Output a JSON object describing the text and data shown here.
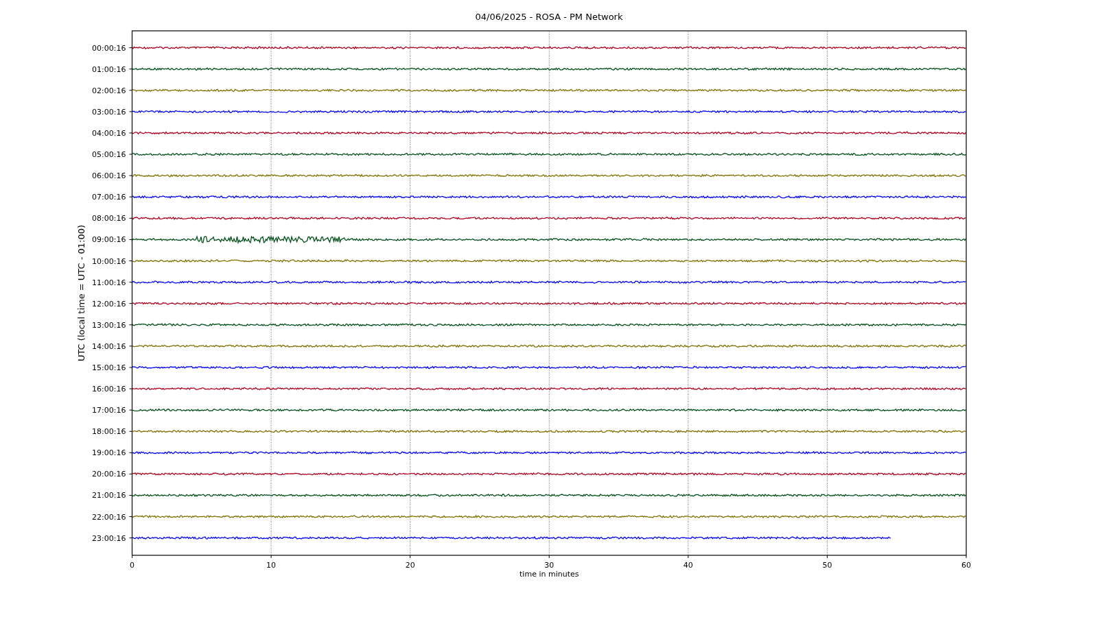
{
  "title": "04/06/2025 - ROSA - PM Network",
  "ylabel": "UTC (local time = UTC - 01:00)",
  "xlabel": "time in minutes",
  "xticks": [
    "0",
    "10",
    "20",
    "30",
    "40",
    "50",
    "60"
  ],
  "rows": [
    {
      "label": "00:00:16",
      "color": "#b00020",
      "level": 1
    },
    {
      "label": "01:00:16",
      "color": "#00501a",
      "level": 1
    },
    {
      "label": "02:00:16",
      "color": "#7f7000",
      "level": 1
    },
    {
      "label": "03:00:16",
      "color": "#0000ff",
      "level": 1
    },
    {
      "label": "04:00:16",
      "color": "#b00020",
      "level": 1
    },
    {
      "label": "05:00:16",
      "color": "#00501a",
      "level": 1
    },
    {
      "label": "06:00:16",
      "color": "#7f7000",
      "level": 1
    },
    {
      "label": "07:00:16",
      "color": "#0000ff",
      "level": 1
    },
    {
      "label": "08:00:16",
      "color": "#b00020",
      "level": 1
    },
    {
      "label": "09:00:16",
      "color": "#00501a",
      "level": 1
    },
    {
      "label": "10:00:16",
      "color": "#7f7000",
      "level": 1
    },
    {
      "label": "11:00:16",
      "color": "#0000ff",
      "level": 1
    },
    {
      "label": "12:00:16",
      "color": "#b00020",
      "level": 1
    },
    {
      "label": "13:00:16",
      "color": "#00501a",
      "level": 1
    },
    {
      "label": "14:00:16",
      "color": "#7f7000",
      "level": 1
    },
    {
      "label": "15:00:16",
      "color": "#0000ff",
      "level": 1
    },
    {
      "label": "16:00:16",
      "color": "#b00020",
      "level": 1
    },
    {
      "label": "17:00:16",
      "color": "#00501a",
      "level": 1
    },
    {
      "label": "18:00:16",
      "color": "#7f7000",
      "level": 1
    },
    {
      "label": "19:00:16",
      "color": "#0000ff",
      "level": 1
    },
    {
      "label": "20:00:16",
      "color": "#b00020",
      "level": 1
    },
    {
      "label": "21:00:16",
      "color": "#00501a",
      "level": 1
    },
    {
      "label": "22:00:16",
      "color": "#7f7000",
      "level": 1
    },
    {
      "label": "23:00:16",
      "color": "#0000ff",
      "level": 0.91
    }
  ]
}
